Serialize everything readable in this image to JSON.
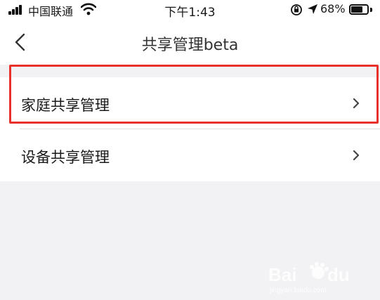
{
  "status_bar": {
    "carrier": "中国联通",
    "time": "下午1:43",
    "battery": "68%"
  },
  "nav": {
    "title": "共享管理beta"
  },
  "menu": {
    "items": [
      {
        "label": "家庭共享管理",
        "highlighted": true
      },
      {
        "label": "设备共享管理",
        "highlighted": false
      }
    ]
  },
  "colors": {
    "highlight": "#e8302c",
    "background": "#f2f2f4"
  },
  "icons": [
    "back-chevron-icon",
    "chevron-right-icon",
    "wifi-icon",
    "signal-icon",
    "battery-icon",
    "location-arrow-icon",
    "rotation-lock-icon"
  ]
}
